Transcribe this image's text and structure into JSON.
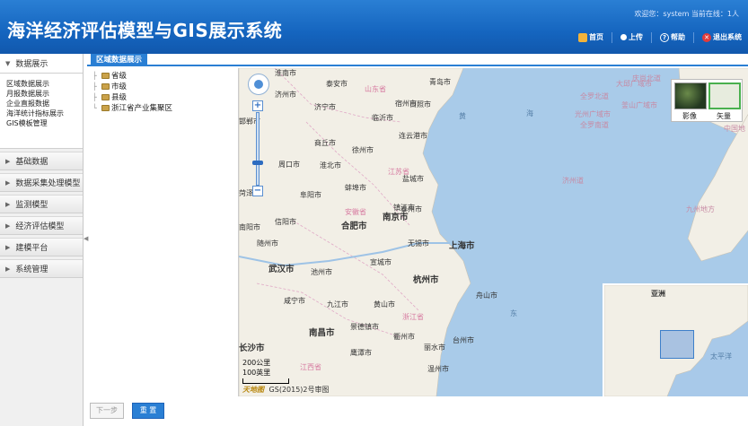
{
  "header": {
    "title": "海洋经济评估模型与GIS展示系统",
    "welcome": "欢迎您：system 当前在线：1人",
    "nav": [
      {
        "label": "首页",
        "icon": "home-icon",
        "color": "#f2b33a"
      },
      {
        "label": "上传",
        "icon": "upload-icon",
        "color": "#ffffff"
      },
      {
        "label": "帮助",
        "icon": "help-icon",
        "color": "#ffffff"
      },
      {
        "label": "退出系统",
        "icon": "exit-icon",
        "color": "#e23b3b"
      }
    ]
  },
  "sidebar": {
    "open_section": "数据展示",
    "sub_items": [
      "区域数据展示",
      "月报数据展示",
      "企业直报数据",
      "海洋统计指标展示",
      "GIS模板管理"
    ],
    "sections": [
      "基础数据",
      "数据采集处理模型",
      "监测模型",
      "经济评估模型",
      "建模平台",
      "系统管理"
    ]
  },
  "tab": {
    "label": "区域数据展示"
  },
  "tree": {
    "items": [
      "省级",
      "市级",
      "县级",
      "浙江省产业集聚区"
    ]
  },
  "map": {
    "labels": {
      "cities": [
        "泰安市",
        "青岛市",
        "日照市",
        "济宁市",
        "临沂市",
        "连云港市",
        "商丘市",
        "徐州市",
        "周口市",
        "淮北市",
        "宿州市",
        "蚌埠市",
        "盐城市",
        "阜阳市",
        "泰州市",
        "南京市",
        "合肥市",
        "信阳市",
        "随州市",
        "无锡市",
        "上海市",
        "宣城市",
        "武汉市",
        "池州市",
        "杭州市",
        "舟山市",
        "咸宁市",
        "九江市",
        "黄山市",
        "景德镇市",
        "南昌市",
        "衢州市",
        "丽水市",
        "台州市",
        "鹰潭市",
        "温州市",
        "长沙市",
        "菏泽市",
        "南阳市",
        "邯郸市",
        "济州市",
        "淮南市",
        "镇江市"
      ],
      "provinces": [
        "山东省",
        "江苏省",
        "安徽省",
        "江西省",
        "浙江省"
      ],
      "seas": [
        "黄",
        "海",
        "济州道",
        "九州地方",
        "东"
      ],
      "japan": [
        "全罗北道",
        "大邱广域市",
        "庆尚北道",
        "釜山广域市",
        "光州广域市",
        "全罗南道",
        "中国地"
      ]
    },
    "layers": {
      "image": "影像",
      "vector": "矢量",
      "active": "vector"
    },
    "overview": {
      "region": "亚洲",
      "ocean": "太平洋"
    },
    "scale": {
      "km": "200公里",
      "mi": "100英里"
    },
    "copyright": {
      "brand": "天地图",
      "text": "GS(2015)2号审图"
    }
  },
  "buttons": {
    "prev": "下一步",
    "reset": "重 置"
  },
  "colors": {
    "header": "#1565bf",
    "accent": "#2a7fd4",
    "land": "#f2efe6",
    "water": "#a9cbe9"
  }
}
